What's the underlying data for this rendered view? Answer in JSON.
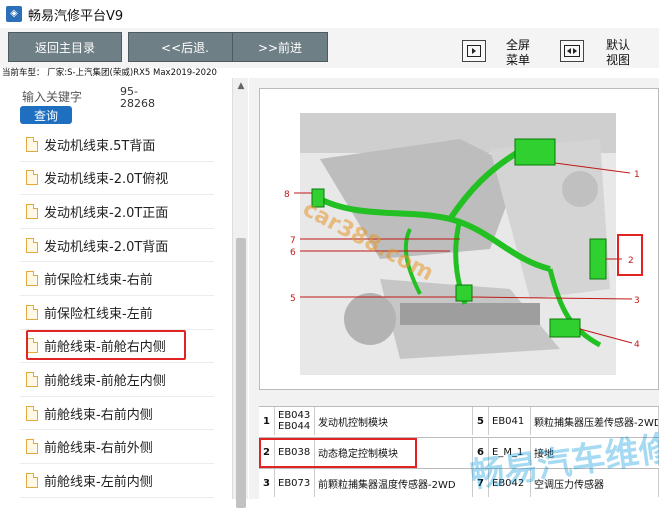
{
  "window": {
    "title": "畅易汽修平台V9",
    "icon": "app-logo-icon"
  },
  "toolbar": {
    "back_main": "返回主目录",
    "back": "<<后退.",
    "forward": ">>前进",
    "fullscreen_label": "全屏\n菜单",
    "default_view_label": "默认\n视图"
  },
  "model_line": "当前车型： 厂家:S-上汽集团(荣威)RX5 Max2019-2020",
  "search": {
    "label": "输入关键字",
    "value": "95-\n28268",
    "button": "查询"
  },
  "list": {
    "items": [
      "发动机线束.5T背面",
      "发动机线束-2.0T俯视",
      "发动机线束-2.0T正面",
      "发动机线束-2.0T背面",
      "前保险杠线束-右前",
      "前保险杠线束-左前",
      "前舱线束-前舱右内侧",
      "前舱线束-前舱左内侧",
      "前舱线束-右前内侧",
      "前舱线束-右前外侧",
      "前舱线束-左前内侧"
    ],
    "selected_index": 6
  },
  "figure": {
    "callouts": [
      "1",
      "2",
      "3",
      "4",
      "5",
      "6",
      "7",
      "8"
    ],
    "watermark": "car388.com",
    "highlight_callout": "2"
  },
  "table": {
    "rows": [
      {
        "n1": "1",
        "c1": "EB043\nEB044",
        "d1": "发动机控制模块",
        "n2": "5",
        "c2": "EB041",
        "d2": "颗粒捕集器压差传感器-2WD"
      },
      {
        "n1": "2",
        "c1": "EB038",
        "d1": "动态稳定控制模块",
        "n2": "6",
        "c2": "E_M_1",
        "d2": "接地"
      },
      {
        "n1": "3",
        "c1": "EB073",
        "d1": "前颗粒捕集器温度传感器-2WD",
        "n2": "7",
        "c2": "EB042",
        "d2": "空调压力传感器"
      }
    ],
    "highlight_row": 1
  },
  "watermark_text": "畅易汽车维修",
  "colors": {
    "button_bg": "#6f7f86",
    "query_bg": "#1e6fc0",
    "highlight": "#e02424",
    "harness": "#22c022"
  }
}
